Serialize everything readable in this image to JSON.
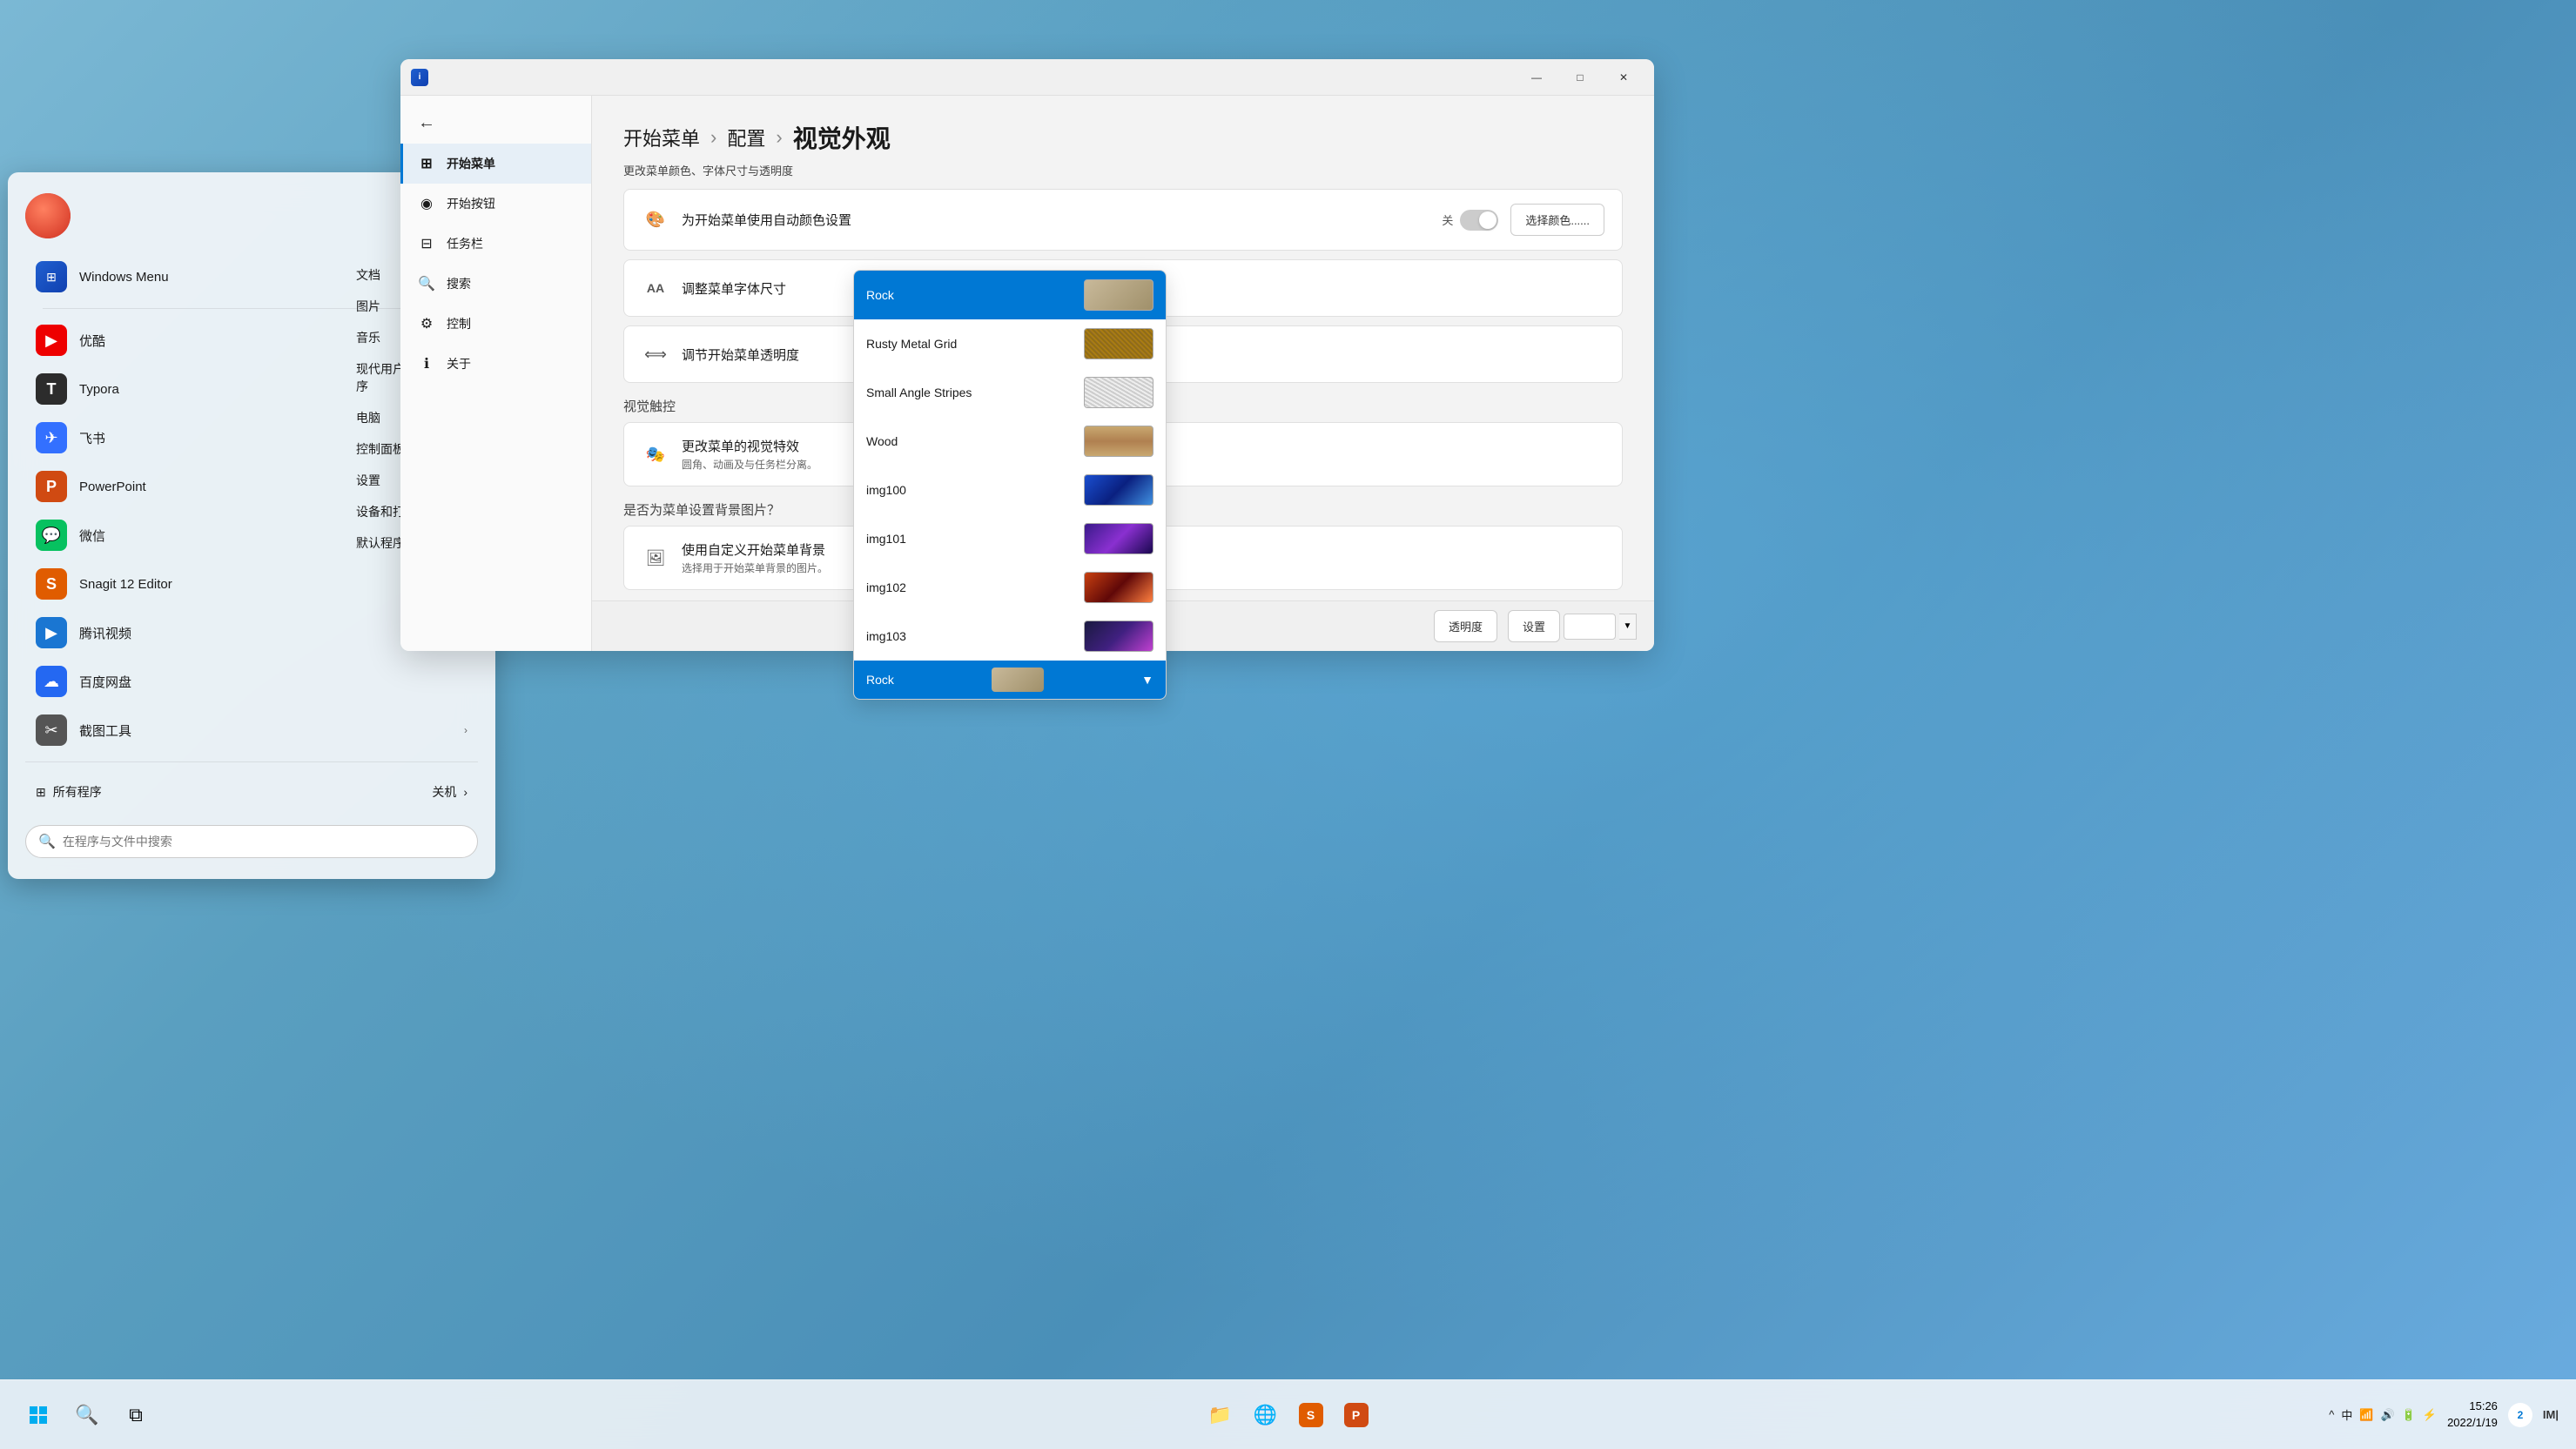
{
  "desktop": {
    "background": "Windows 11 blue flower desktop"
  },
  "start_menu": {
    "user_avatar_label": "User Avatar",
    "windows_menu_item": "Windows Menu",
    "apps": [
      {
        "id": "youku",
        "label": "优酷",
        "color": "#e00",
        "icon": "▶"
      },
      {
        "id": "typora",
        "label": "Typora",
        "color": "#2c2c2c",
        "icon": "T",
        "arrow": true
      },
      {
        "id": "feishu",
        "label": "飞书",
        "color": "#3370ff",
        "icon": "✈"
      },
      {
        "id": "powerpoint",
        "label": "PowerPoint",
        "color": "#d04a12",
        "icon": "P",
        "arrow": true
      },
      {
        "id": "wechat",
        "label": "微信",
        "color": "#07c160",
        "icon": "💬"
      },
      {
        "id": "snagit",
        "label": "Snagit 12 Editor",
        "color": "#e05c00",
        "icon": "S",
        "arrow": true
      },
      {
        "id": "tencentvideo",
        "label": "腾讯视频",
        "color": "#1a76d2",
        "icon": "▶",
        "arrow": true
      },
      {
        "id": "baidupan",
        "label": "百度网盘",
        "color": "#2468f2",
        "icon": "☁"
      },
      {
        "id": "jietu",
        "label": "截图工具",
        "color": "#555",
        "icon": "✂",
        "arrow": true
      }
    ],
    "right_column": {
      "items": [
        "文档",
        "图片",
        "音乐",
        "现代用户界面应用程序",
        "电脑",
        "控制面板",
        "设置",
        "设备和打印机",
        "默认程序"
      ]
    },
    "all_apps": "所有程序",
    "shutdown": "关机",
    "shutdown_arrow": "›",
    "search_placeholder": "在程序与文件中搜索"
  },
  "app_window": {
    "title_icon": "i",
    "minimize_label": "—",
    "maximize_label": "□",
    "close_label": "✕",
    "sidebar": {
      "back_label": "←",
      "items": [
        {
          "id": "start-menu",
          "label": "开始菜单",
          "icon": "⊞",
          "active": true
        },
        {
          "id": "start-btn",
          "label": "开始按钮",
          "icon": "◉"
        },
        {
          "id": "taskbar",
          "label": "任务栏",
          "icon": "⊟"
        },
        {
          "id": "search",
          "label": "搜索",
          "icon": "🔍"
        },
        {
          "id": "control",
          "label": "控制",
          "icon": "⚙"
        },
        {
          "id": "about",
          "label": "关于",
          "icon": "ℹ"
        }
      ]
    },
    "breadcrumb": {
      "root": "开始菜单",
      "arrow1": "›",
      "mid": "配置",
      "arrow2": "›",
      "current": "视觉外观"
    },
    "section_title": "更改菜单颜色、字体尺寸与透明度",
    "settings": [
      {
        "id": "auto-color",
        "icon": "🎨",
        "label": "为开始菜单使用自动颜色设置",
        "toggle_label": "关",
        "toggle_state": "off",
        "has_color_btn": true,
        "color_btn_label": "选择颜色......"
      },
      {
        "id": "font-size",
        "icon": "AA",
        "label": "调整菜单字体尺寸",
        "has_dropdown": false
      },
      {
        "id": "transparency",
        "icon": "⟺",
        "label": "调节开始菜单透明度",
        "has_dropdown": false
      }
    ],
    "visual_touch_title": "视觉触控",
    "visual_effects": {
      "icon": "🎭",
      "label": "更改菜单的视觉特效",
      "sublabel": "圆角、动画及与任务栏分离。"
    },
    "background_section": "是否为菜单设置背景图片？",
    "custom_bg": {
      "icon": "🖼",
      "label": "使用自定义开始菜单背景",
      "sublabel": "选择用于开始菜单背景的图片。"
    },
    "bottom_bar": {
      "transparency_label": "透明度",
      "settings_label": "设置",
      "settings_value": ""
    }
  },
  "dropdown": {
    "items": [
      {
        "id": "rock",
        "label": "Rock",
        "color": "#c8b99a",
        "selected": true
      },
      {
        "id": "rusty-metal-grid",
        "label": "Rusty Metal Grid",
        "color": "#b8860b"
      },
      {
        "id": "small-angle-stripes",
        "label": "Small Angle Stripes",
        "color": "#ddd"
      },
      {
        "id": "wood",
        "label": "Wood",
        "color": "#c8a870"
      },
      {
        "id": "img100",
        "label": "img100",
        "color": "#1a4fd0",
        "image": true
      },
      {
        "id": "img101",
        "label": "img101",
        "color": "#3a1a8a",
        "image": true
      },
      {
        "id": "img102",
        "label": "img102",
        "color": "#c84010",
        "image": true
      },
      {
        "id": "img103",
        "label": "img103",
        "color": "#1a1a40",
        "image": true
      }
    ],
    "footer_label": "Rock",
    "footer_arrow": "▼"
  },
  "taskbar": {
    "start_label": "Start",
    "search_label": "Search",
    "task_view_label": "Task View",
    "apps": [
      {
        "id": "explorer-files",
        "icon": "📁",
        "label": "File Explorer"
      },
      {
        "id": "edge",
        "icon": "🌐",
        "label": "Edge"
      },
      {
        "id": "snagit-tb",
        "icon": "S",
        "label": "Snagit"
      },
      {
        "id": "ppt-tb",
        "icon": "P",
        "label": "PowerPoint"
      }
    ],
    "systray": {
      "chevron": "^",
      "ime": "中",
      "wifi": "📶",
      "volume": "🔊",
      "battery": "🔋",
      "network_extra": "⚡"
    },
    "time": "15:26",
    "date": "2022/1/19",
    "notification_count": "2",
    "end_icon": "IM|"
  }
}
